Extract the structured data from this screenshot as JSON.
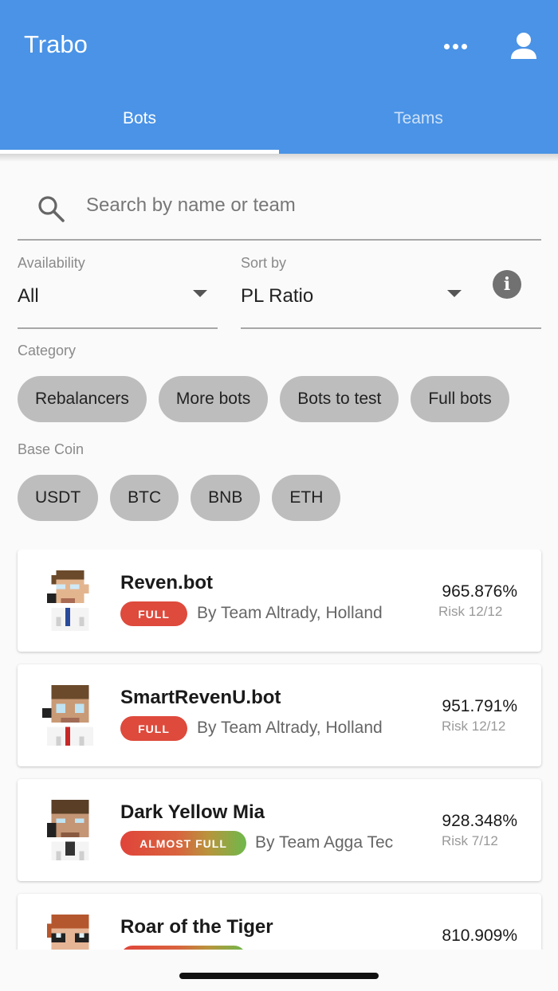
{
  "app": {
    "title": "Trabo"
  },
  "tabs": [
    {
      "label": "Bots",
      "active": true
    },
    {
      "label": "Teams",
      "active": false
    }
  ],
  "search": {
    "placeholder": "Search by name or team",
    "value": ""
  },
  "filters": {
    "availability": {
      "label": "Availability",
      "value": "All"
    },
    "sort": {
      "label": "Sort by",
      "value": "PL Ratio"
    }
  },
  "category": {
    "label": "Category",
    "chips": [
      "Rebalancers",
      "More bots",
      "Bots to test",
      "Full bots"
    ]
  },
  "base_coin": {
    "label": "Base Coin",
    "chips": [
      "USDT",
      "BTC",
      "BNB",
      "ETH"
    ]
  },
  "bots": [
    {
      "name": "Reven.bot",
      "badge": "FULL",
      "team": "By Team Altrady, Holland",
      "pl": "965.876%",
      "risk": "Risk 12/12"
    },
    {
      "name": "SmartRevenU.bot",
      "badge": "FULL",
      "team": "By Team Altrady, Holland",
      "pl": "951.791%",
      "risk": "Risk 12/12"
    },
    {
      "name": "Dark Yellow Mia",
      "badge": "ALMOST FULL",
      "team": "By Team Agga Tec",
      "pl": "928.348%",
      "risk": "Risk 7/12"
    },
    {
      "name": "Roar of the Tiger",
      "badge": "",
      "team": "",
      "pl": "810.909%",
      "risk": ""
    }
  ],
  "colors": {
    "primary": "#4a93e6",
    "full_badge": "#de4a3c",
    "chip_bg": "#bdbdbd"
  },
  "icons": {
    "more": "more-horiz-icon",
    "user": "person-icon",
    "search": "search-icon",
    "info": "info-icon",
    "dropdown": "arrow-drop-down-icon"
  }
}
